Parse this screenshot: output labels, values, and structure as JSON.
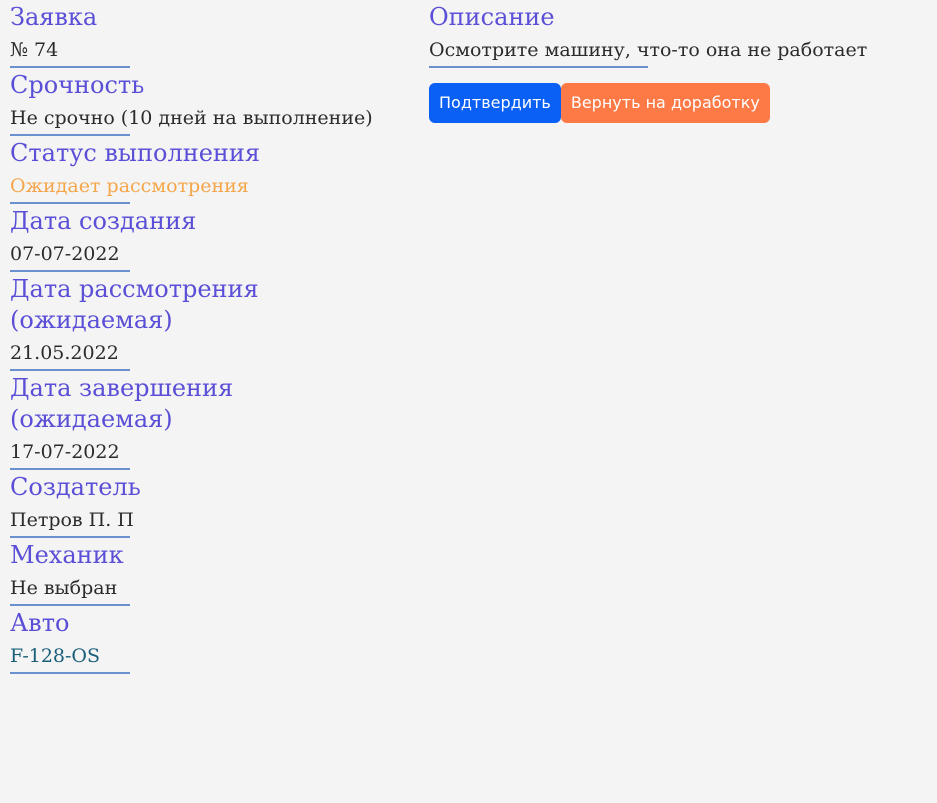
{
  "request": {
    "fields": [
      {
        "label": "Заявка",
        "value": "№ 74"
      },
      {
        "label": "Срочность",
        "value": "Не срочно (10 дней на выполнение)"
      },
      {
        "label": "Статус выполнения",
        "value": "Ожидает рассмотрения"
      },
      {
        "label": "Дата создания",
        "value": "07-07-2022"
      },
      {
        "label": "Дата рассмотрения (ожидаемая)",
        "value": "21.05.2022"
      },
      {
        "label": "Дата завершения (ожидаемая)",
        "value": "17-07-2022"
      },
      {
        "label": "Создатель",
        "value": "Петров П. П"
      },
      {
        "label": "Механик",
        "value": "Не выбран"
      },
      {
        "label": "Авто",
        "value": "F-128-OS"
      }
    ]
  },
  "description": {
    "label": "Описание",
    "value": "Осмотрите машину, что-то она не работает"
  },
  "actions": {
    "confirm_label": "Подтвердить",
    "return_label": "Вернуть на доработку"
  },
  "colors": {
    "label": "#5a4fd6",
    "status_pending": "#f5a64a",
    "auto_value": "#1a5f7a",
    "confirm_button": "#0a5ff5",
    "return_button": "#fd7a46",
    "divider": "#6c8fd0"
  }
}
